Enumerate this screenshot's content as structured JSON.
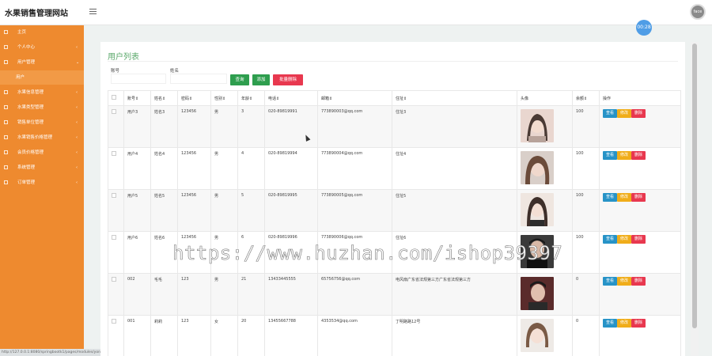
{
  "app": {
    "title": "水果销售管理网站",
    "clock": "00:28",
    "avatar_label": "face"
  },
  "sidebar": {
    "items": [
      {
        "label": "主页",
        "icon": "flag-icon",
        "chev": ""
      },
      {
        "label": "个人中心",
        "icon": "list-icon",
        "chev": "‹"
      },
      {
        "label": "用户管理",
        "icon": "list-icon",
        "chev": "⌄"
      },
      {
        "label": "用户",
        "icon": "",
        "chev": ""
      },
      {
        "label": "水果信息管理",
        "icon": "list-icon",
        "chev": "‹"
      },
      {
        "label": "水果类型管理",
        "icon": "list-icon",
        "chev": "‹"
      },
      {
        "label": "销售单位管理",
        "icon": "list-icon",
        "chev": "‹"
      },
      {
        "label": "水果销售价格管理",
        "icon": "list-icon",
        "chev": "‹"
      },
      {
        "label": "会员价格管理",
        "icon": "list-icon",
        "chev": "‹"
      },
      {
        "label": "系统管理",
        "icon": "list-icon",
        "chev": "‹"
      },
      {
        "label": "订单管理",
        "icon": "list-icon",
        "chev": "‹"
      }
    ],
    "status_url": "http://127.0.0.1:8080/springbootk1/pages/modules/yonghu/list.jsp"
  },
  "panel": {
    "title": "用户列表",
    "search": {
      "account_label": "账号",
      "name_label": "姓名"
    },
    "buttons": {
      "query": "查询",
      "add": "添加",
      "batch_delete": "批量删除"
    }
  },
  "table": {
    "headers": [
      "",
      "账号⇕",
      "姓名⇕",
      "密码⇕",
      "性别⇕",
      "年龄⇕",
      "电话⇕",
      "邮箱⇕",
      "住址⇕",
      "头像",
      "余额⇕",
      "操作"
    ],
    "rows": [
      {
        "account": "用户3",
        "name": "姓名3",
        "password": "123456",
        "gender": "男",
        "age": "3",
        "phone": "020-89819991",
        "email": "773890003@qq.com",
        "address": "住址3",
        "balance": "100"
      },
      {
        "account": "用户4",
        "name": "姓名4",
        "password": "123456",
        "gender": "男",
        "age": "4",
        "phone": "020-89819994",
        "email": "773890004@qq.com",
        "address": "住址4",
        "balance": "100"
      },
      {
        "account": "用户5",
        "name": "姓名5",
        "password": "123456",
        "gender": "男",
        "age": "5",
        "phone": "020-89819995",
        "email": "773890005@qq.com",
        "address": "住址5",
        "balance": "100"
      },
      {
        "account": "用户6",
        "name": "姓名6",
        "password": "123456",
        "gender": "男",
        "age": "6",
        "phone": "020-89819996",
        "email": "773890006@qq.com",
        "address": "住址6",
        "balance": "100"
      },
      {
        "account": "002",
        "name": "毛毛",
        "password": "123",
        "gender": "男",
        "age": "21",
        "phone": "13433445555",
        "email": "65756756@qq.com",
        "address": "电风扇广东省法规第三方广东省法规第三方",
        "balance": "0"
      },
      {
        "account": "001",
        "name": "莉莉",
        "password": "123",
        "gender": "女",
        "age": "20",
        "phone": "13455667788",
        "email": "4353534@qq.com",
        "address": "丁明路路12号",
        "balance": "0"
      }
    ],
    "actions": {
      "view": "查看",
      "edit": "修改",
      "delete": "删除"
    }
  },
  "watermark": "https://www.huzhan.com/ishop39397",
  "colors": {
    "sidebar": "#ee8a2f",
    "title_green": "#5aa86a",
    "btn_green": "#2e9e4e",
    "btn_red": "#e8384f",
    "view_blue": "#2793c7",
    "edit_yellow": "#f0ad1a"
  }
}
